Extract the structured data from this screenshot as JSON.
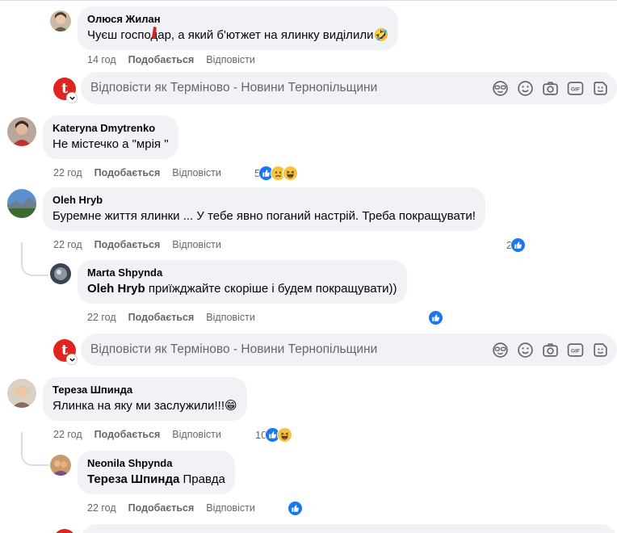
{
  "comments": [
    {
      "author": "Олюся Жилан",
      "text": "Чуєш госп​одар, а який б'ютжет на ялинку виділили",
      "text_emoji": "🤣",
      "time": "14 год",
      "like": "Подобається",
      "reply": "Відповісти"
    },
    {
      "author": "Kateryna Dmytrenko",
      "text": "Не містечко а \"мрія \"",
      "time": "22 год",
      "like": "Подобається",
      "reply": "Відповісти",
      "reactions_count": "5"
    },
    {
      "author": "Oleh Hryb",
      "text": "Буремне життя ялинки ... У тебе явно поганий настрій. Треба покращувати!",
      "time": "22 год",
      "like": "Подобається",
      "reply": "Відповісти",
      "reactions_count": "2"
    },
    {
      "author": "Marta Shpynda",
      "mention": "Oleh Hryb",
      "text": " приїжджайте скоріше і будем покращувати))",
      "time": "22 год",
      "like": "Подобається",
      "reply": "Відповісти"
    },
    {
      "author": "Тереза Шпинда",
      "text": "Ялинка на яку ми заслужили!!!",
      "text_emoji": "😁",
      "time": "22 год",
      "like": "Подобається",
      "reply": "Відповісти",
      "reactions_count": "10"
    },
    {
      "author": "Neonila Shpynda",
      "mention": "Тереза Шпинда",
      "text": " Правда",
      "time": "22 год",
      "like": "Подобається",
      "reply": "Відповісти"
    }
  ],
  "reply_box": {
    "placeholder": "Відповісти як Терміново - Новини Тернопільщини",
    "page_initial": "t",
    "gif_label": "GIF"
  },
  "colors": {
    "bubble": "#f0f2f5",
    "meta": "#65676b",
    "like_blue": "#1877f2",
    "page_red": "#e0241f"
  }
}
